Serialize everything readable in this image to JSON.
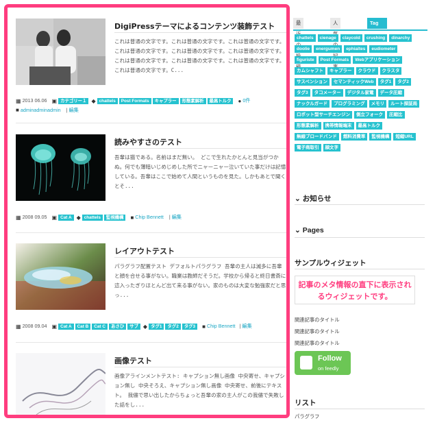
{
  "posts": [
    {
      "title": "DigiPressテーマによるコンテンツ装飾テスト",
      "excerpt": "これは普通の文字です。これは普通の文字です。これは普通の文字です。これは普通の文字です。これは普通の文字です。これは普通の文字です。これは普通の文字です。これは普通の文字です。これは普通の文字です。これは普通の文字です。C...",
      "date": "2013 06.06",
      "categories": [
        "カテゴリー１"
      ],
      "tags": [
        "chattels",
        "Post Formats",
        "キャプラー",
        "形態素解析",
        "最高トルク"
      ],
      "comments": "0件",
      "author": "adminadminadmin",
      "edit": "編集"
    },
    {
      "title": "読みやすさのテスト",
      "excerpt": "吾輩は猫である。名前はまだ無い。 どこで生れたかとんと見当がつかぬ。何でも薄暗いじめじめした所でニャーニャー泣いていた事だけは記憶している。吾輩はここで始めて人間というものを見た。しかもあとで聞くとそ...",
      "date": "2008 09.05",
      "categories": [
        "Cat A"
      ],
      "tags": [
        "chattels",
        "監視機構"
      ],
      "author": "Chip Bennett",
      "edit": "編集"
    },
    {
      "title": "レイアウトテスト",
      "excerpt": "パラグラフ配置テスト デフォルトパラグラフ 吾輩の主人は滅多に吾輩と顔を合せる事がない。職業は教師だそうだ。学校から帰ると終日書斎に這入ったぎりほとんど出て来る事がない。家のものは大変な勉強家だと思っ...",
      "date": "2008 09.04",
      "categories": [
        "Cat A",
        "Cat B",
        "Cat C",
        "あさひ",
        "サブ"
      ],
      "tags": [
        "タグ1",
        "タグ2",
        "タグ3"
      ],
      "author": "Chip Bennett",
      "edit": "編集"
    },
    {
      "title": "画像テスト",
      "excerpt": "画像アラインメントテスト: キャプション無し画像 中央寄せ、キャプション無し 中央そろえ、キャプション無し画像 中央寄せ、前後にテキスト。 我儘で思い出したからちょっと吾輩の家の主人がこの我儘で失敗した話をし..."
    }
  ],
  "sidebar": {
    "tabs": [
      "最近の投稿",
      "人気の記事",
      "Tag Cloud"
    ],
    "tag_cloud": [
      "chattels",
      "cienage",
      "claycold",
      "crushing",
      "dinarchy",
      "doolie",
      "energumen",
      "ephialtes",
      "eudiometer",
      "figuriste",
      "Post Formats",
      "Webアプリケーション",
      "カムシャフト",
      "キャプラー",
      "クラウド",
      "クラスタ",
      "サスペンション",
      "セマンティックWeb",
      "タグ1",
      "タグ2",
      "タグ3",
      "タコメーター",
      "デジタル家電",
      "データ圧縮",
      "ナックルガード",
      "プログラミング",
      "メモリ",
      "ルート探証局",
      "ロボット型サーチエンジン",
      "側立フォーク",
      "圧縮比",
      "形態素解析",
      "携帯情報端末",
      "最高トルク",
      "無線ブロードバンド",
      "燃料消費率",
      "監視機構",
      "短縮URL",
      "電子商取引",
      "顔文字"
    ],
    "widget_news": "お知らせ",
    "widget_pages": "Pages",
    "widget_sample": "サンプルウィジェット",
    "meta_widget_text": "記事のメタ情報の直下に表示されるウィジェットです。",
    "related": [
      "関連記事のタイトル",
      "関連記事のタイトル",
      "関連記事のタイトル"
    ],
    "feedly_follow": "Follow",
    "feedly_on": "on feedly",
    "list_heading": "リスト",
    "list_item": "パラグラフ"
  },
  "colors": {
    "accent": "#26c2cf",
    "frame": "#ff3d7f",
    "feedly": "#6cc655"
  }
}
